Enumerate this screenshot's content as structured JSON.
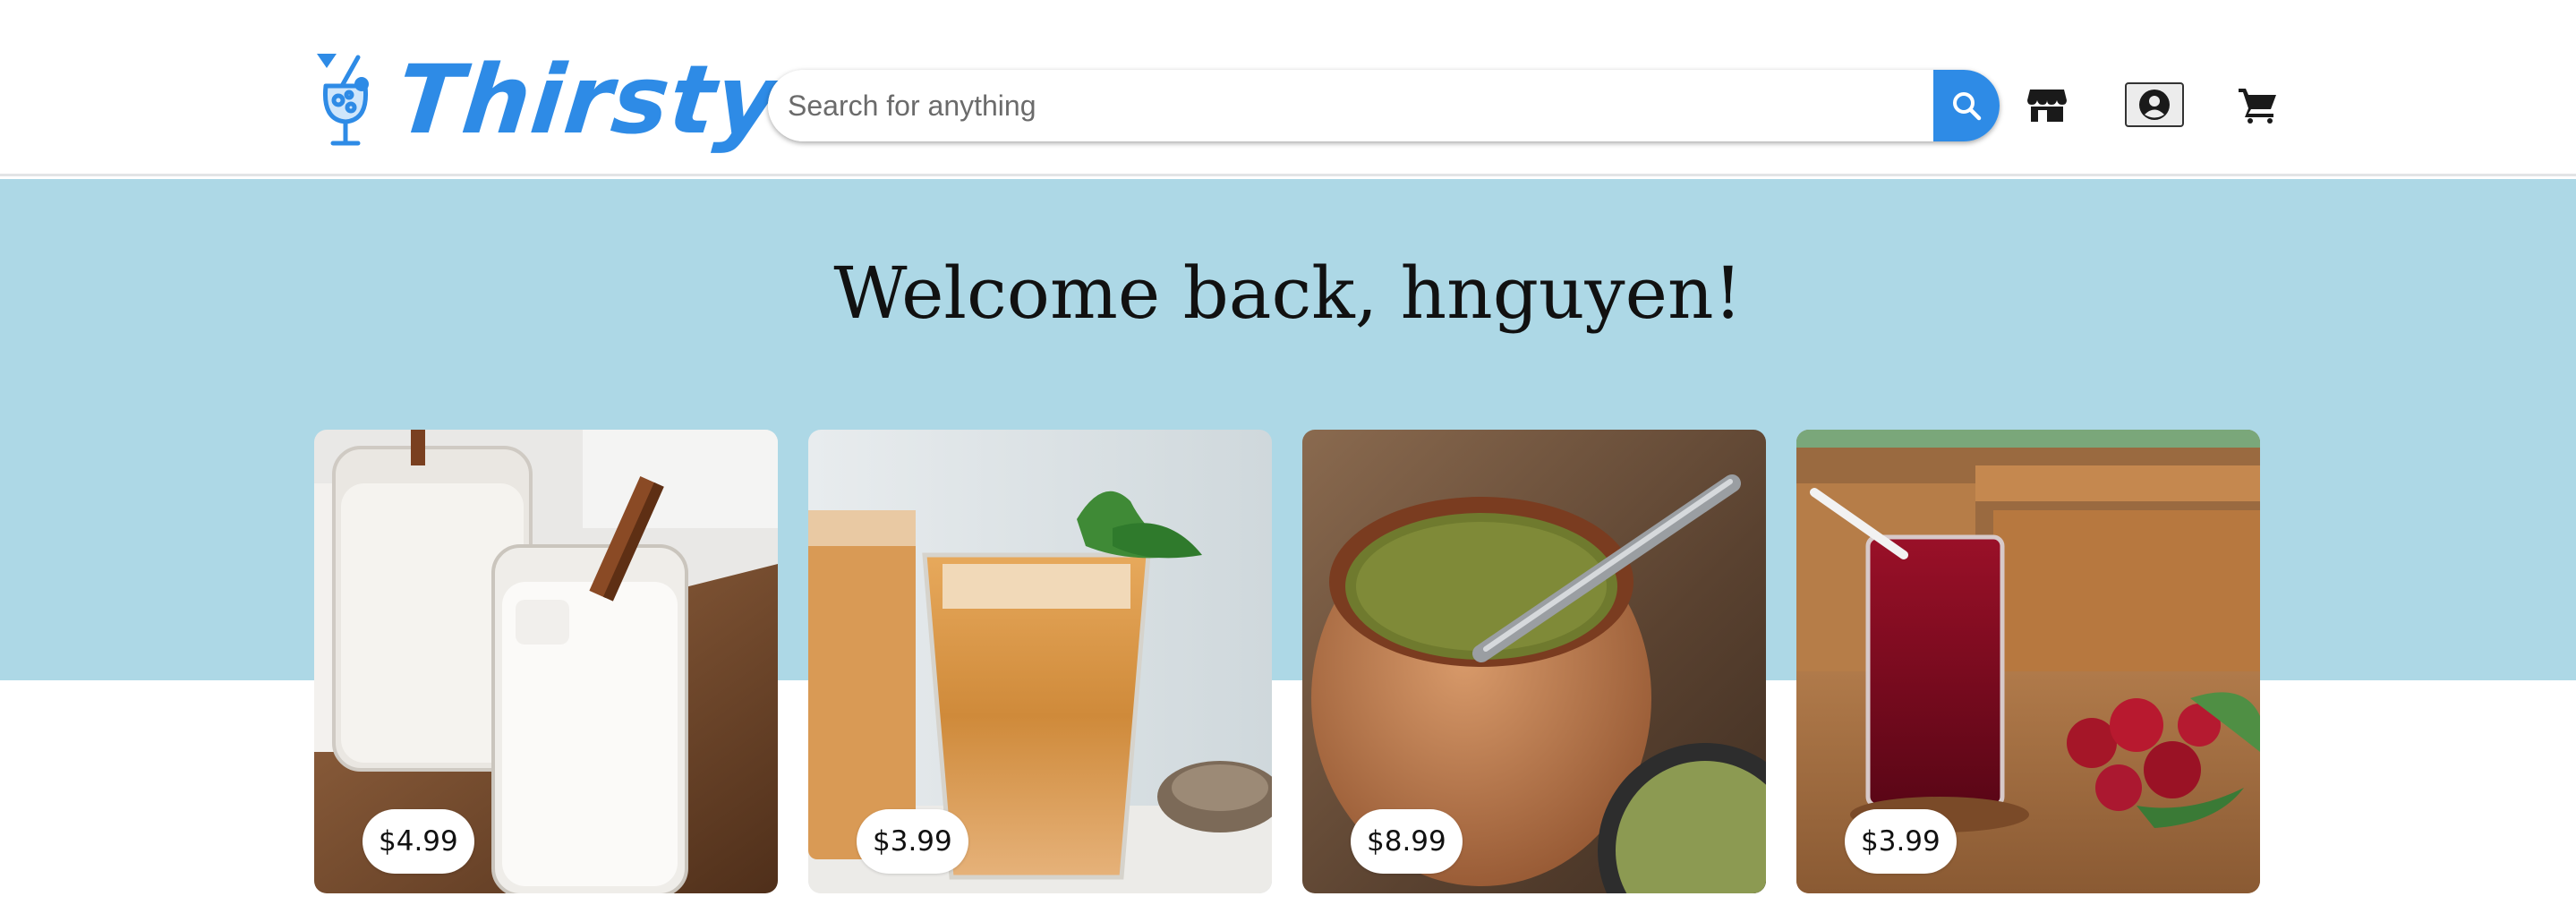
{
  "brand": {
    "name": "Thirsty",
    "color": "#2e8be6",
    "icon": "cocktail-glass-icon"
  },
  "search": {
    "placeholder": "Search for anything",
    "value": "",
    "button_icon": "search-icon"
  },
  "nav_icons": [
    "store-icon",
    "account-icon",
    "cart-icon"
  ],
  "hero": {
    "greeting": "Welcome back, hnguyen!",
    "background": "#add8e6"
  },
  "products": [
    {
      "image": "horchata-drink-image",
      "price": "$4.99"
    },
    {
      "image": "thai-iced-tea-image",
      "price": "$3.99"
    },
    {
      "image": "yerba-mate-gourd-image",
      "price": "$8.99"
    },
    {
      "image": "hibiscus-iced-tea-image",
      "price": "$3.99"
    }
  ]
}
